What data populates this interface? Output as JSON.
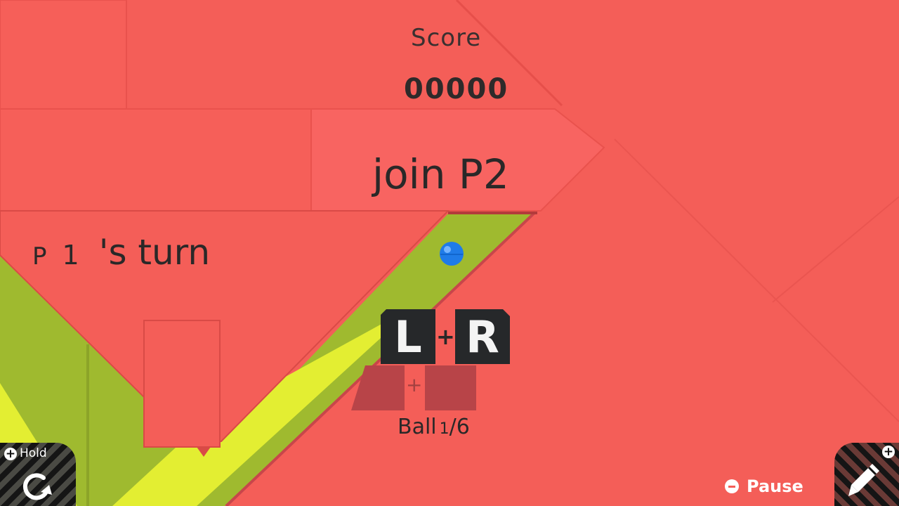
{
  "hud": {
    "score_label": "Score",
    "score_value": "00000",
    "join_text": "join P2",
    "turn": {
      "player_prefix": "P",
      "player_number": "1",
      "suffix": "'s turn"
    },
    "balls": {
      "label": "Ball",
      "current": "1",
      "total": "/6"
    }
  },
  "controls": {
    "left_key": "L",
    "plus": "+",
    "right_key": "R",
    "shadow_plus": "+",
    "hold_label": "Hold",
    "hold_plus": "+",
    "edit_plus": "+",
    "pause_label": "Pause"
  },
  "colors": {
    "background": "#f45e58",
    "track_olive": "#9fba2f",
    "track_yellow": "#e3ee32",
    "ball": "#1f7be8",
    "key_bg": "#26282a"
  },
  "icons": {
    "hold": "rotate-arrow-icon",
    "edit": "pencil-icon",
    "pause": "minus-circle-icon",
    "plus": "plus-circle-icon"
  }
}
